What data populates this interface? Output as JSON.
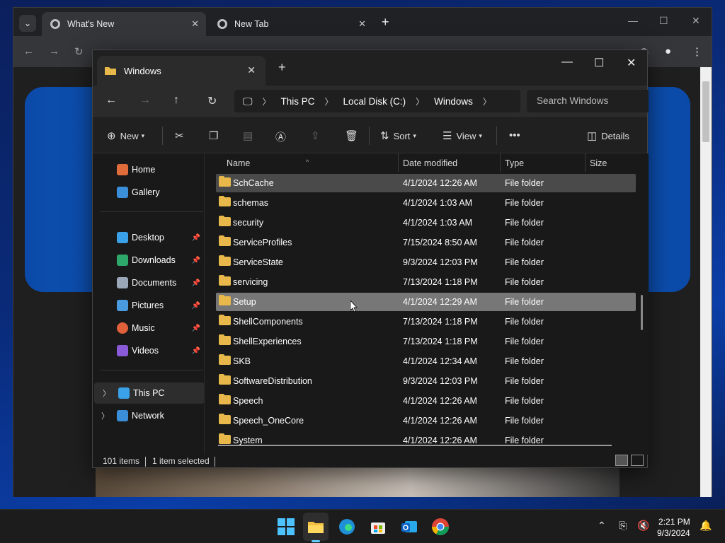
{
  "chrome": {
    "tabs": [
      {
        "label": "What's New",
        "active": true
      },
      {
        "label": "New Tab",
        "active": false
      }
    ]
  },
  "explorer": {
    "tab_title": "Windows",
    "breadcrumb": [
      "This PC",
      "Local Disk (C:)",
      "Windows"
    ],
    "search_placeholder": "Search Windows",
    "commands": {
      "new_label": "New",
      "sort_label": "Sort",
      "view_label": "View",
      "details_label": "Details"
    },
    "nav_items": [
      {
        "label": "Home",
        "icon": "home-icon"
      },
      {
        "label": "Gallery",
        "icon": "gallery-icon"
      },
      {
        "label": "Desktop",
        "icon": "desktop-icon",
        "pinned": true
      },
      {
        "label": "Downloads",
        "icon": "downloads-icon",
        "pinned": true
      },
      {
        "label": "Documents",
        "icon": "documents-icon",
        "pinned": true
      },
      {
        "label": "Pictures",
        "icon": "pictures-icon",
        "pinned": true
      },
      {
        "label": "Music",
        "icon": "music-icon",
        "pinned": true
      },
      {
        "label": "Videos",
        "icon": "videos-icon",
        "pinned": true
      },
      {
        "label": "This PC",
        "icon": "this-pc-icon"
      },
      {
        "label": "Network",
        "icon": "network-icon"
      }
    ],
    "columns": [
      "Name",
      "Date modified",
      "Type",
      "Size"
    ],
    "files": [
      {
        "name": "SchCache",
        "date": "4/1/2024 12:26 AM",
        "type": "File folder"
      },
      {
        "name": "schemas",
        "date": "4/1/2024 1:03 AM",
        "type": "File folder"
      },
      {
        "name": "security",
        "date": "4/1/2024 1:03 AM",
        "type": "File folder"
      },
      {
        "name": "ServiceProfiles",
        "date": "7/15/2024 8:50 AM",
        "type": "File folder"
      },
      {
        "name": "ServiceState",
        "date": "9/3/2024 12:03 PM",
        "type": "File folder"
      },
      {
        "name": "servicing",
        "date": "7/13/2024 1:18 PM",
        "type": "File folder"
      },
      {
        "name": "Setup",
        "date": "4/1/2024 12:29 AM",
        "type": "File folder"
      },
      {
        "name": "ShellComponents",
        "date": "7/13/2024 1:18 PM",
        "type": "File folder"
      },
      {
        "name": "ShellExperiences",
        "date": "7/13/2024 1:18 PM",
        "type": "File folder"
      },
      {
        "name": "SKB",
        "date": "4/1/2024 12:34 AM",
        "type": "File folder"
      },
      {
        "name": "SoftwareDistribution",
        "date": "9/3/2024 12:03 PM",
        "type": "File folder"
      },
      {
        "name": "Speech",
        "date": "4/1/2024 12:26 AM",
        "type": "File folder"
      },
      {
        "name": "Speech_OneCore",
        "date": "4/1/2024 12:26 AM",
        "type": "File folder"
      },
      {
        "name": "System",
        "date": "4/1/2024 12:26 AM",
        "type": "File folder"
      }
    ],
    "status": {
      "item_count": "101 items",
      "selection": "1 item selected"
    }
  },
  "taskbar": {
    "time": "2:21 PM",
    "date": "9/3/2024"
  }
}
